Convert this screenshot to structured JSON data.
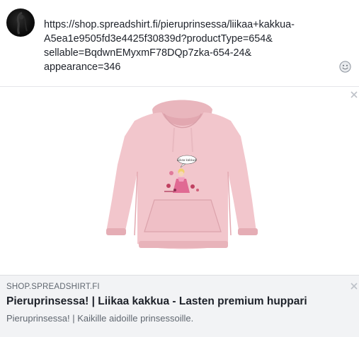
{
  "composer": {
    "url_lines": [
      "https://shop.spreadshirt.fi/pieruprinsessa/liikaa+kakkua-",
      "A5ea1e9505fd3e4425f30839d?productType=654&",
      "sellable=BqdwnEMyxmF78DQp7zka-654-24&",
      "appearance=346"
    ],
    "emoji_icon": "smiley-face-icon"
  },
  "preview": {
    "image_alt": "pink hoodie",
    "hoodie_color": "#f2c6cc",
    "speech_bubble_text": "Liikaa kakkua!"
  },
  "link": {
    "domain": "SHOP.SPREADSHIRT.FI",
    "title": "Pieruprinsessa! | Liikaa kakkua - Lasten premium huppari",
    "description": "Pieruprinsessa! | Kaikille aidoille prinsessoille."
  },
  "colors": {
    "footer_bg": "#f2f3f5",
    "muted_text": "#606770",
    "main_text": "#1d2129"
  }
}
